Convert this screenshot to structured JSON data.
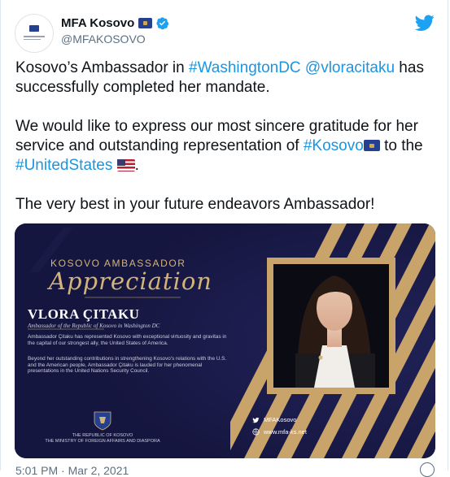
{
  "account": {
    "name": "MFA Kosovo",
    "handle": "@MFAKOSOVO"
  },
  "tweet": {
    "p1": {
      "pre": "Kosovo’s Ambassador in ",
      "tag1": "#WashingtonDC",
      "mid": " ",
      "mention": "@vloracitaku",
      "post": " has successfully completed her mandate."
    },
    "p2": {
      "pre": "We would like to express our most sincere gratitude for her service and outstanding representation of ",
      "tag1": "#Kosovo",
      "mid": " to the ",
      "tag2": "#UnitedStates",
      "post": "."
    },
    "p3": "The very best in your future endeavors Ambassador!",
    "timestamp": "5:01 PM · Mar 2, 2021"
  },
  "card": {
    "kicker": "KOSOVO AMBASSADOR",
    "script_title": "Appreciation",
    "person_name": "VLORA ÇITAKU",
    "person_title": "Ambassador of the Republic of Kosovo in Washington DC",
    "paragraph1": "Ambassador Çitaku has represented Kosovo with exceptional virtuosity and gravitas in the capital of our strongest ally, the United States of America.",
    "paragraph2": "Beyond her outstanding contributions in strengthening Kosovo's relations with the U.S. and the American people, Ambassador Çitaku is lauded for her phenomenal presentations in the United Nations Security Council.",
    "institution_line1": "THE REPUBLIC OF KOSOVO",
    "institution_line2": "THE MINISTRY OF FOREIGN AFFAIRS AND DIASPORA",
    "social_twitter": "MFAKosovo",
    "social_web": "www.mfa-ks.net"
  },
  "colors": {
    "link": "#1b95e0",
    "card_bg": "#15163f",
    "gold": "#d4b37a"
  },
  "icons": [
    "twitter-bird-icon",
    "verified-badge-icon",
    "kosovo-flag-icon",
    "us-flag-icon",
    "info-icon",
    "globe-icon"
  ]
}
